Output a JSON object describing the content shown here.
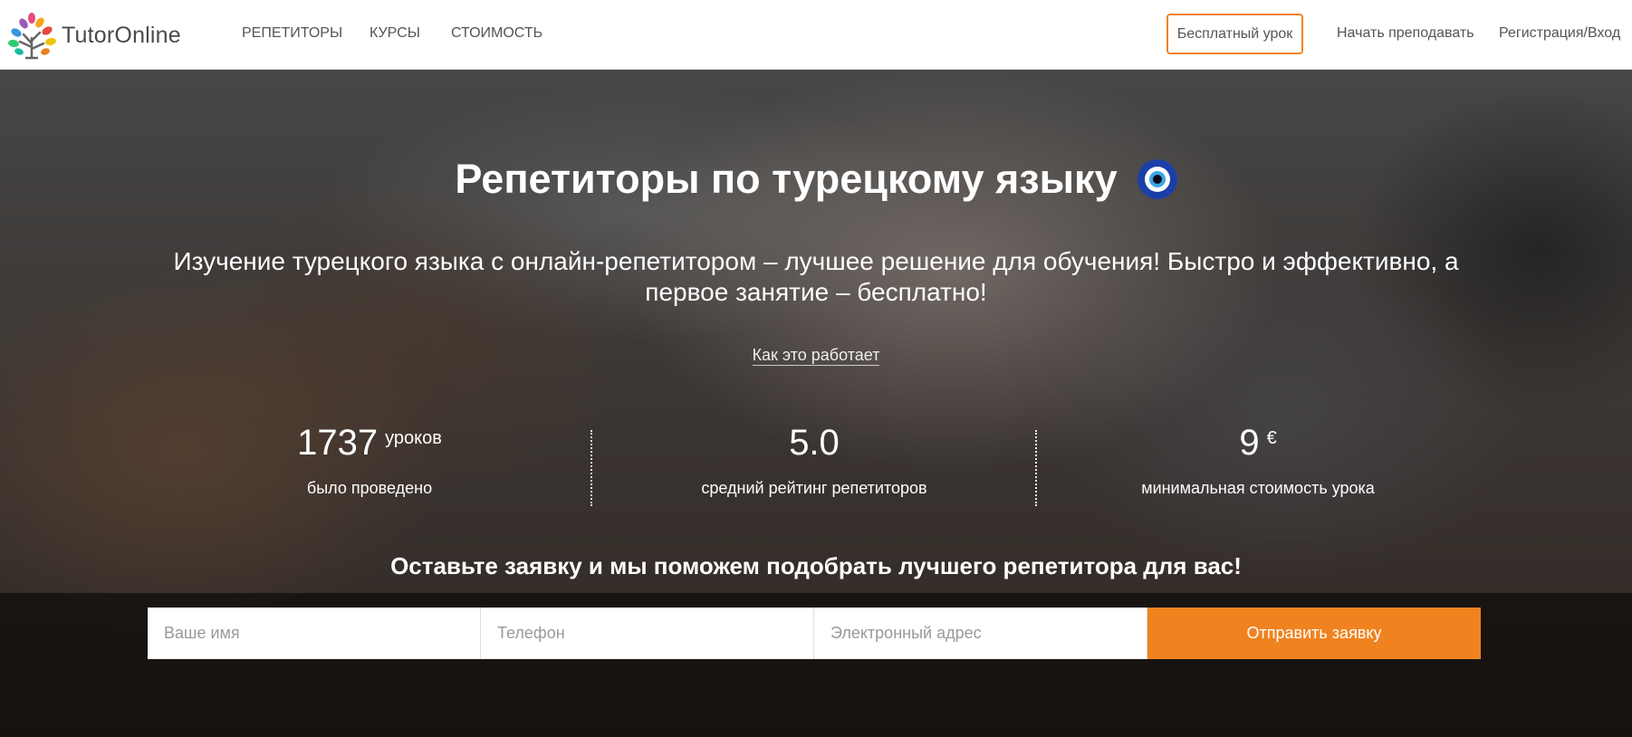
{
  "header": {
    "logo_text": "TutorOnline",
    "nav": {
      "tutors": "РЕПЕТИТОРЫ",
      "courses": "КУРСЫ",
      "price": "СТОИМОСТЬ"
    },
    "free_lesson": "Бесплатный урок",
    "teach": "Начать преподавать",
    "login": "Регистрация/Вход"
  },
  "hero": {
    "title": "Репетиторы по турецкому языку",
    "subtitle": "Изучение турецкого языка с онлайн-репетитором – лучшее решение для обучения! Быстро и эффективно, а первое занятие – бесплатно!",
    "how_it_works": "Как это работает",
    "stats": [
      {
        "number": "1737",
        "unit": "уроков",
        "label": "было проведено"
      },
      {
        "number": "5.0",
        "unit": "",
        "label": "средний рейтинг репетиторов"
      },
      {
        "number": "9",
        "unit": "€",
        "label": "минимальная стоимость урока"
      }
    ]
  },
  "request": {
    "title": "Оставьте заявку и мы поможем подобрать лучшего репетитора для вас!",
    "name_placeholder": "Ваше имя",
    "phone_placeholder": "Телефон",
    "email_placeholder": "Электронный адрес",
    "submit": "Отправить заявку"
  },
  "colors": {
    "accent": "#f08320",
    "eye_blue": "#1b3fa8"
  }
}
